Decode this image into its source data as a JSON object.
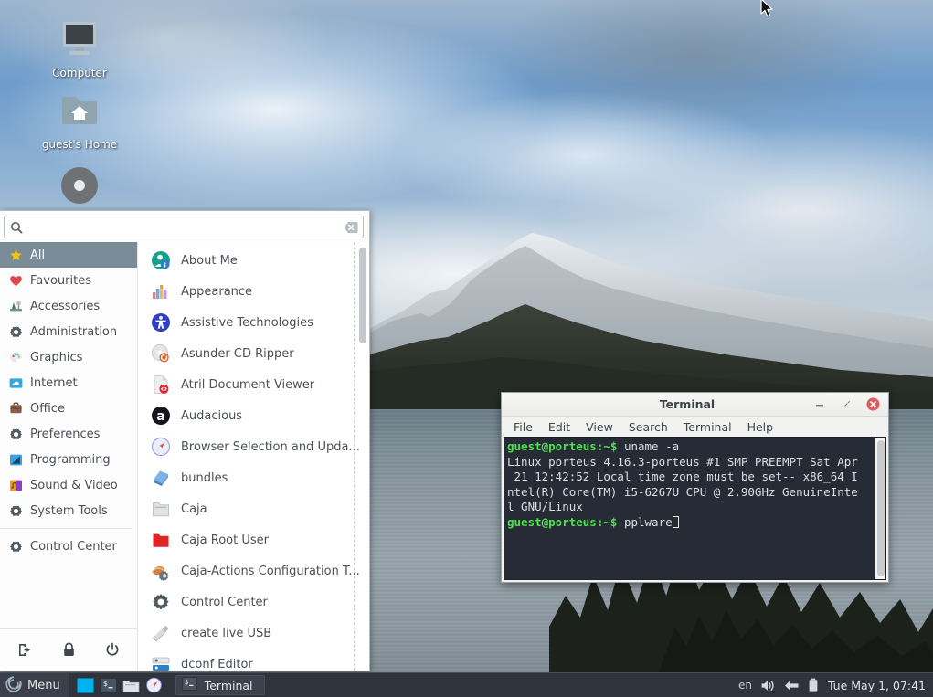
{
  "desktop": {
    "icons": [
      {
        "name": "computer",
        "label": "Computer",
        "icon": "computer-icon"
      },
      {
        "name": "home",
        "label": "guest's Home",
        "icon": "home-folder-icon"
      },
      {
        "name": "media",
        "label": "",
        "icon": "disc-icon"
      }
    ]
  },
  "menu": {
    "search": {
      "value": "",
      "placeholder": "",
      "icon": "search-icon",
      "clear_icon": "clear-icon"
    },
    "categories": [
      {
        "label": "All",
        "icon": "star-icon",
        "selected": true
      },
      {
        "label": "Favourites",
        "icon": "heart-icon",
        "selected": false
      },
      {
        "label": "Accessories",
        "icon": "accessories-icon",
        "selected": false
      },
      {
        "label": "Administration",
        "icon": "gear-icon",
        "selected": false
      },
      {
        "label": "Graphics",
        "icon": "palette-icon",
        "selected": false
      },
      {
        "label": "Internet",
        "icon": "cloud-icon",
        "selected": false
      },
      {
        "label": "Office",
        "icon": "briefcase-icon",
        "selected": false
      },
      {
        "label": "Preferences",
        "icon": "gear-icon",
        "selected": false
      },
      {
        "label": "Programming",
        "icon": "code-icon",
        "selected": false
      },
      {
        "label": "Sound & Video",
        "icon": "music-icon",
        "selected": false
      },
      {
        "label": "System Tools",
        "icon": "gear-icon",
        "selected": false
      }
    ],
    "extra_category": {
      "label": "Control Center",
      "icon": "gear-icon"
    },
    "power_buttons": [
      {
        "name": "logout",
        "icon": "logout-icon"
      },
      {
        "name": "lock",
        "icon": "lock-icon"
      },
      {
        "name": "shutdown",
        "icon": "power-icon"
      }
    ],
    "applications": [
      {
        "label": "About Me",
        "icon": "about-me-icon"
      },
      {
        "label": "Appearance",
        "icon": "appearance-icon"
      },
      {
        "label": "Assistive Technologies",
        "icon": "accessibility-icon"
      },
      {
        "label": "Asunder CD Ripper",
        "icon": "cd-ripper-icon"
      },
      {
        "label": "Atril Document Viewer",
        "icon": "document-viewer-icon"
      },
      {
        "label": "Audacious",
        "icon": "audacious-icon"
      },
      {
        "label": "Browser Selection and Upda...",
        "icon": "compass-icon"
      },
      {
        "label": "bundles",
        "icon": "bundles-icon"
      },
      {
        "label": "Caja",
        "icon": "folder-icon"
      },
      {
        "label": "Caja Root User",
        "icon": "red-folder-icon"
      },
      {
        "label": "Caja-Actions Configuration T...",
        "icon": "caja-actions-icon"
      },
      {
        "label": "Control Center",
        "icon": "gear-icon"
      },
      {
        "label": "create live USB",
        "icon": "usb-icon"
      },
      {
        "label": "dconf Editor",
        "icon": "dconf-icon"
      }
    ]
  },
  "terminal": {
    "title": "Terminal",
    "window_buttons": [
      {
        "name": "minimize",
        "icon": "minimize-icon"
      },
      {
        "name": "maximize",
        "icon": "maximize-icon"
      },
      {
        "name": "close",
        "icon": "close-icon"
      }
    ],
    "menubar": [
      "File",
      "Edit",
      "View",
      "Search",
      "Terminal",
      "Help"
    ],
    "lines": [
      {
        "prompt": "guest@porteus:~$",
        "text": " uname -a"
      },
      {
        "prompt": "",
        "text": "Linux porteus 4.16.3-porteus #1 SMP PREEMPT Sat Apr"
      },
      {
        "prompt": "",
        "text": " 21 12:42:52 Local time zone must be set-- x86_64 I"
      },
      {
        "prompt": "",
        "text": "ntel(R) Core(TM) i5-6267U CPU @ 2.90GHz GenuineInte"
      },
      {
        "prompt": "",
        "text": "l GNU/Linux"
      },
      {
        "prompt": "guest@porteus:~$",
        "text": " pplware",
        "cursor": true
      }
    ],
    "colors": {
      "background": "#272b35",
      "prompt": "#4ee24e",
      "text": "#dcdfe4"
    }
  },
  "taskbar": {
    "menu_label": "Menu",
    "launchers": [
      {
        "name": "show-desktop",
        "icon": "show-desktop-icon"
      },
      {
        "name": "terminal-launcher",
        "icon": "terminal-icon"
      },
      {
        "name": "file-manager-launcher",
        "icon": "folder-icon"
      },
      {
        "name": "browser-launcher",
        "icon": "compass-icon"
      }
    ],
    "tasks": [
      {
        "label": "Terminal",
        "icon": "terminal-icon",
        "active": true
      }
    ],
    "tray": {
      "language": "en",
      "icons": [
        "volume-icon",
        "update-icon",
        "battery-icon"
      ],
      "clock": "Tue May  1, 07:41"
    }
  },
  "colors": {
    "panel": "#2f333b",
    "menu_selected": "#7b8c99",
    "terminal_bg": "#272b35",
    "close_button": "#e05b5b"
  }
}
